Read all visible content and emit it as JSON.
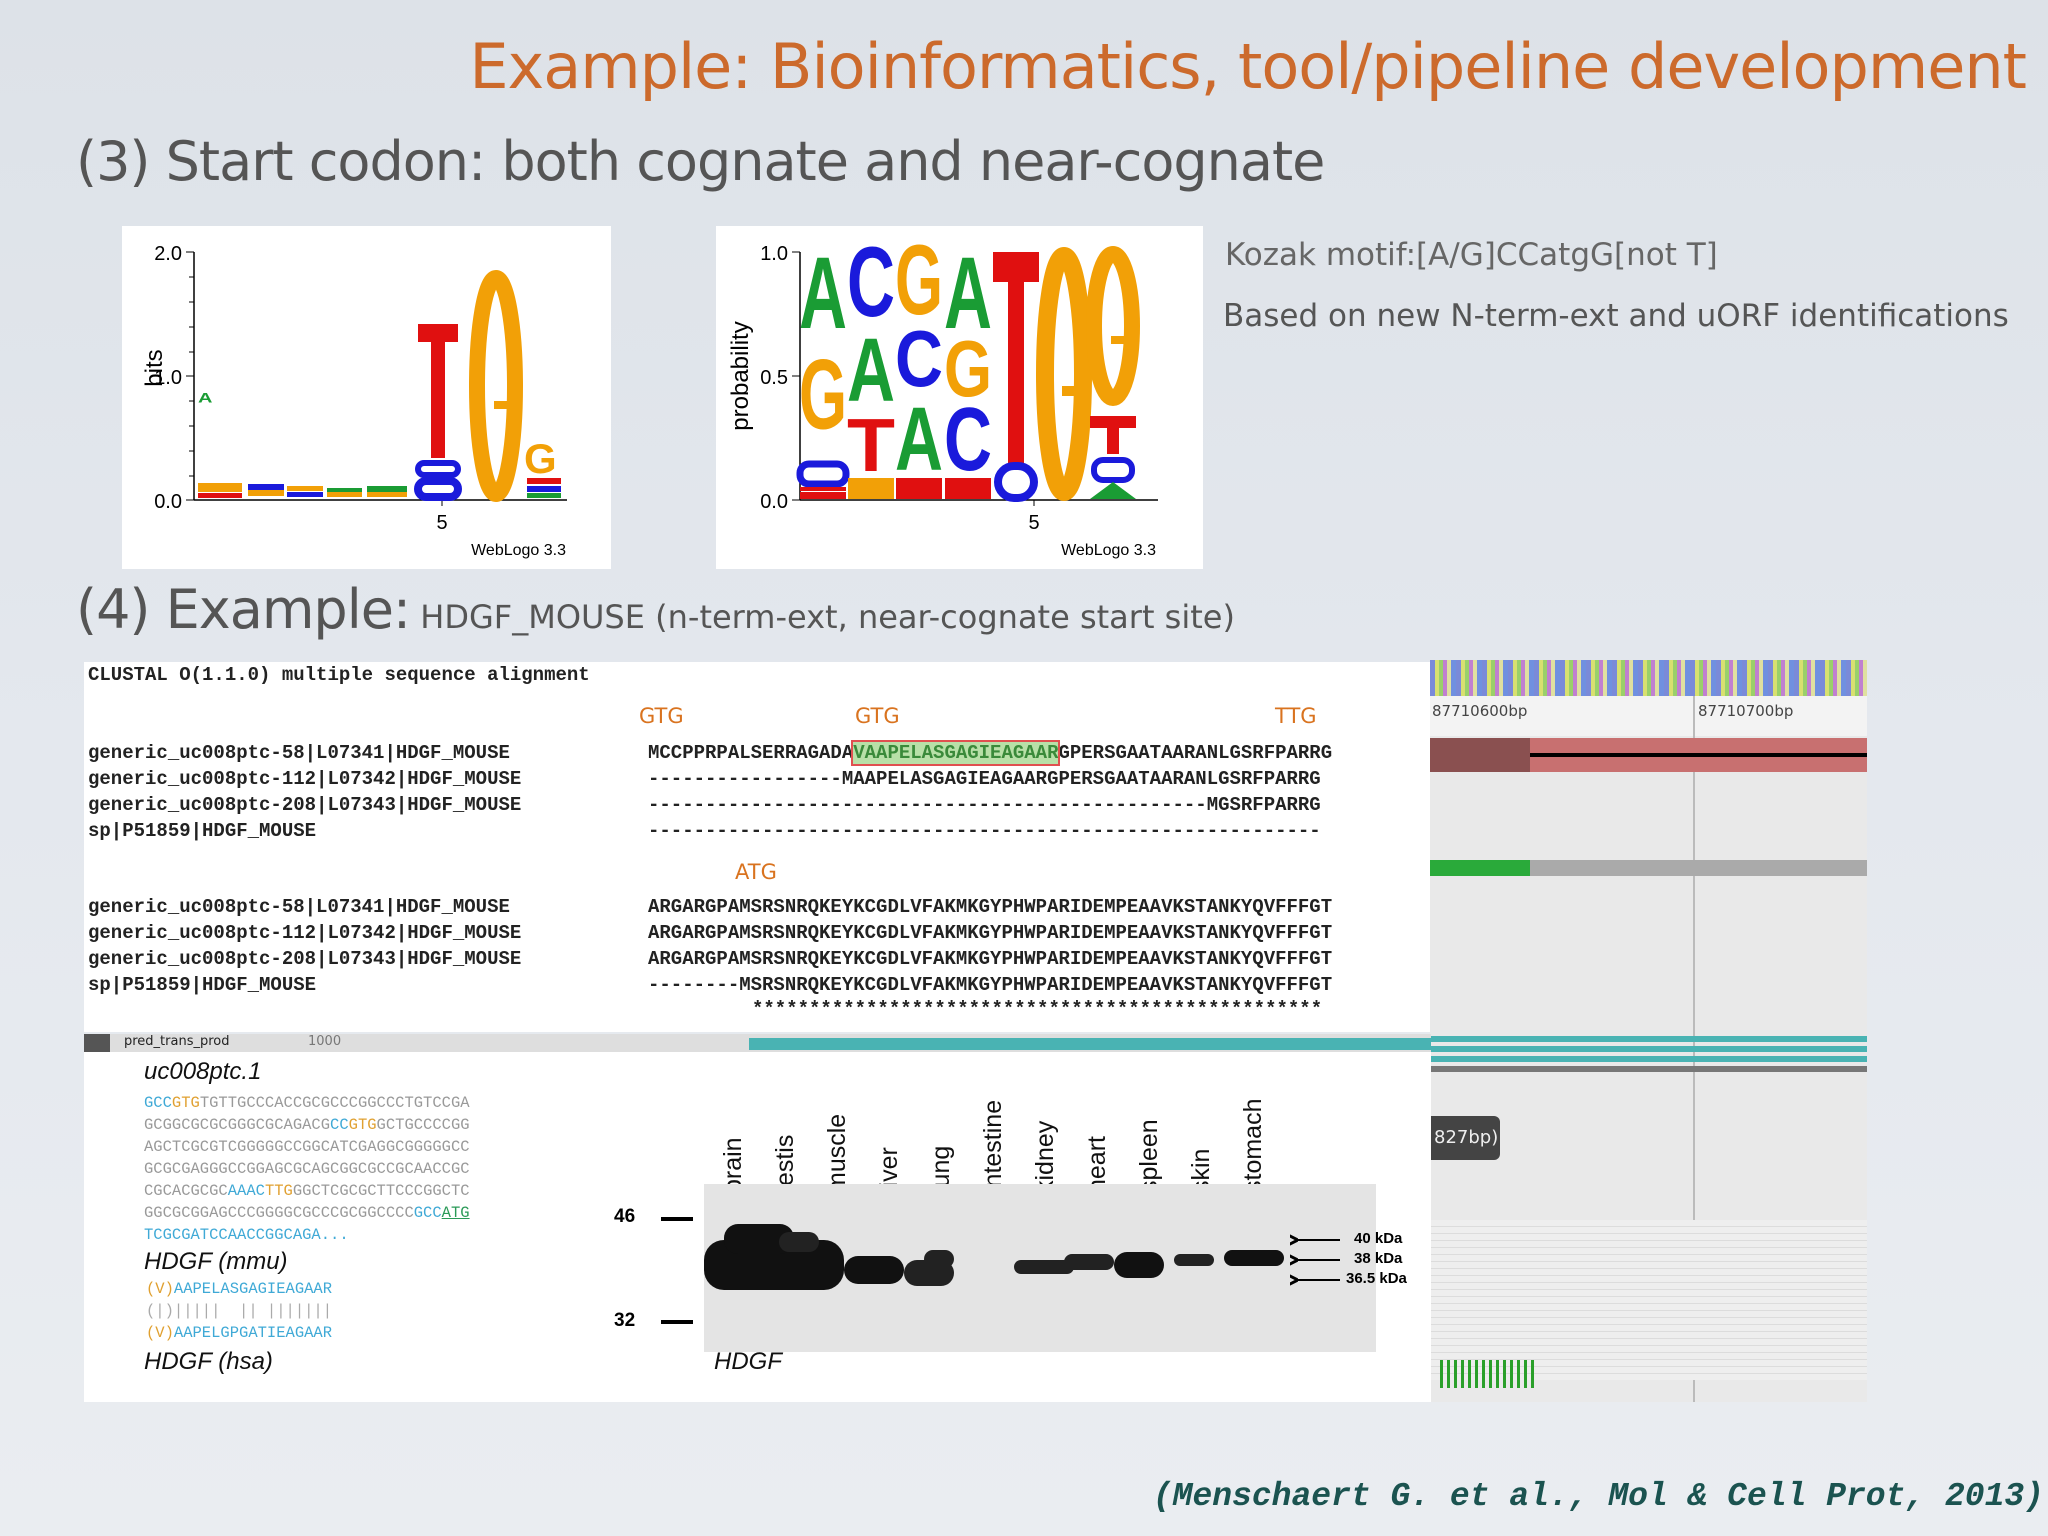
{
  "slide": {
    "title": "Example: Bioinformatics, tool/pipeline development",
    "section3": "(3) Start codon: both cognate and near-cognate",
    "section4_main": "(4) Example:",
    "section4_sub": " HDGF_MOUSE (n-term-ext, near-cognate start site)",
    "kozak": "Kozak motif:[A/G]CCatgG[not T]",
    "based_on": "Based on new N-term-ext and uORF identifications",
    "citation": "(Menschaert G. et al., Mol & Cell Prot, 2013)"
  },
  "logo_bits": {
    "ylabel": "bits",
    "ticks": [
      "2.0",
      "1.0",
      "0.0"
    ],
    "xtick": "5",
    "credit": "WebLogo 3.3"
  },
  "logo_prob": {
    "ylabel": "probability",
    "ticks": [
      "1.0",
      "0.5",
      "0.0"
    ],
    "xtick": "5",
    "credit": "WebLogo 3.3"
  },
  "alignment": {
    "header": "CLUSTAL O(1.1.0) multiple sequence alignment",
    "codon_marks": [
      "GTG",
      "GTG",
      "TTG",
      "ATG"
    ],
    "block1": [
      {
        "name": "generic_uc008ptc-58|L07341|HDGF_MOUSE",
        "seq_a": "MCCPPRPALSERRAGADA",
        "seq_hl": "VAAPELASGAGIEAGAAR",
        "seq_b": "GPERSGAATAARANLGSRFPARRG"
      },
      {
        "name": "generic_uc008ptc-112|L07342|HDGF_MOUSE",
        "seq": "-----------------MAAPELASGAGIEAGAARGPERSGAATAARANLGSRFPARRG"
      },
      {
        "name": "generic_uc008ptc-208|L07343|HDGF_MOUSE",
        "seq": "-------------------------------------------------MGSRFPARRG"
      },
      {
        "name": "sp|P51859|HDGF_MOUSE",
        "seq": "-----------------------------------------------------------"
      }
    ],
    "block2": [
      {
        "name": "generic_uc008ptc-58|L07341|HDGF_MOUSE",
        "seq": "ARGARGPAMSRSNRQKEYKCGDLVFAKMKGYPHWPARIDEMPEAAVKSTANKYQVFFFGT"
      },
      {
        "name": "generic_uc008ptc-112|L07342|HDGF_MOUSE",
        "seq": "ARGARGPAMSRSNRQKEYKCGDLVFAKMKGYPHWPARIDEMPEAAVKSTANKYQVFFFGT"
      },
      {
        "name": "generic_uc008ptc-208|L07343|HDGF_MOUSE",
        "seq": "ARGARGPAMSRSNRQKEYKCGDLVFAKMKGYPHWPARIDEMPEAAVKSTANKYQVFFFGT"
      },
      {
        "name": "sp|P51859|HDGF_MOUSE",
        "seq": "--------MSRSNRQKEYKCGDLVFAKMKGYPHWPARIDEMPEAAVKSTANKYQVFFFGT"
      }
    ],
    "consensus": "**************************************************"
  },
  "browser": {
    "coord1": "87710600bp",
    "coord2": "87710700bp",
    "track_label": "pred_trans_prod",
    "track_num": "1000",
    "bubble": "827bp)"
  },
  "transcript": {
    "name": "uc008ptc.1",
    "seq_lines": [
      [
        {
          "t": "GCC",
          "c": "blue"
        },
        {
          "t": "GTG",
          "c": "gold"
        },
        {
          "t": "TGTTGCCCACCGCGCCCGGCCCTGTCCGA",
          "c": ""
        }
      ],
      [
        {
          "t": "GCGGCGCGCGGGCGCAGACG",
          "c": ""
        },
        {
          "t": "CC",
          "c": "blue"
        },
        {
          "t": "GTG",
          "c": "gold"
        },
        {
          "t": "GCTGCCCCGG",
          "c": ""
        }
      ],
      [
        {
          "t": "AGCTCGCGTCGGGGGCCGGCATCGAGGCGGGGGCC",
          "c": ""
        }
      ],
      [
        {
          "t": "GCGCGAGGGCCGGAGCGCAGCGGCGCCGCAACCGC",
          "c": ""
        }
      ],
      [
        {
          "t": "CGCACGCGC",
          "c": ""
        },
        {
          "t": "AAAC",
          "c": "blue"
        },
        {
          "t": "TTG",
          "c": "gold"
        },
        {
          "t": "GGCTCGCGCTTCCCGGCTC",
          "c": ""
        }
      ],
      [
        {
          "t": "GGCGCGGAGCCCGGGGCGCCCGCGGCCCC",
          "c": ""
        },
        {
          "t": "GCC",
          "c": "blue"
        },
        {
          "t": "ATG",
          "c": "green"
        }
      ],
      [
        {
          "t": "TCGCGATCCAACCGGCAGA...",
          "c": "blue"
        }
      ]
    ],
    "mmu_label": "HDGF (mmu)",
    "hsa_label": "HDGF (hsa)",
    "mmu_v": "(V)",
    "mmu_seq": "AAPELASGAGIEAGAAR",
    "match_line": "(|)|||||  || |||||||",
    "hsa_v": "(V)",
    "hsa_seq": "AAPELGPGATIEAGAAR"
  },
  "western": {
    "tissues": [
      "brain",
      "testis",
      "muscle",
      "liver",
      "lung",
      "intestine",
      "kidney",
      "heart",
      "spleen",
      "skin",
      "stomach"
    ],
    "marker_46": "46",
    "marker_32": "32",
    "band_40": "40 kDa",
    "band_38": "38 kDa",
    "band_365": "36.5 kDa",
    "label": "HDGF"
  }
}
